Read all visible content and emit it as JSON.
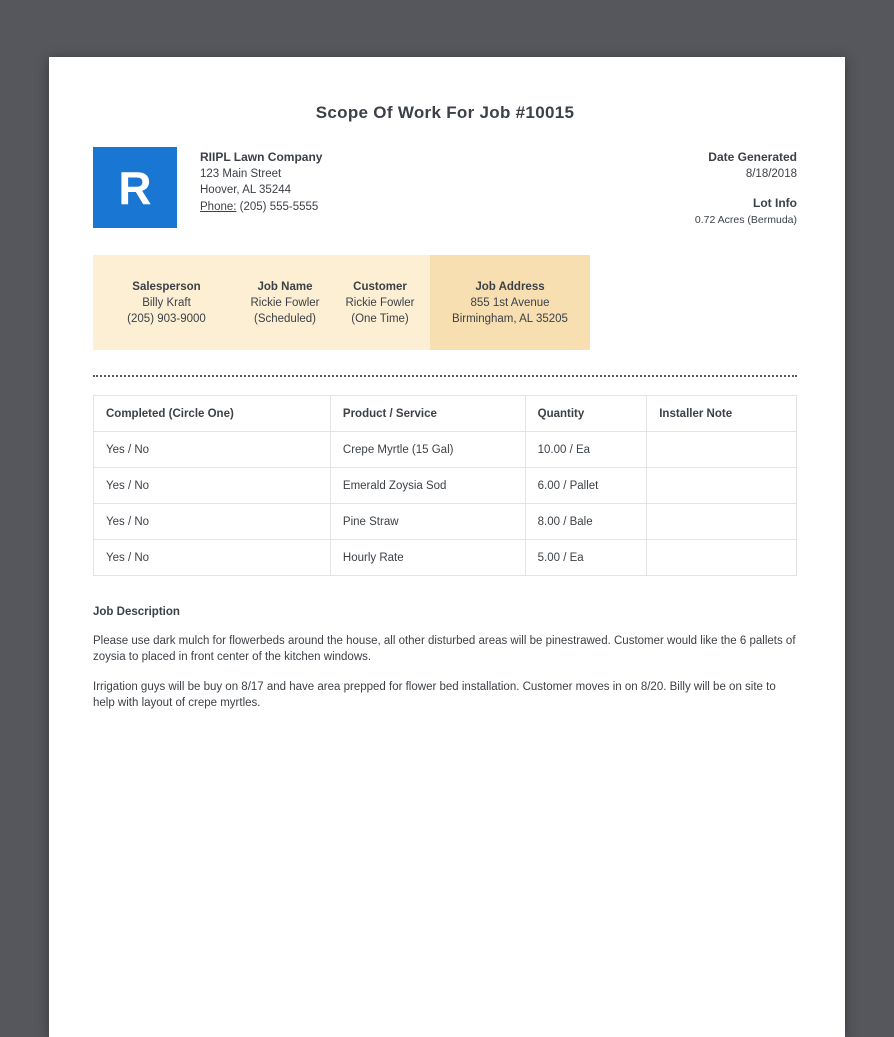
{
  "page": {
    "title": "Scope Of Work For Job #10015"
  },
  "company": {
    "logo_letter": "R",
    "name": "RIIPL Lawn Company",
    "address_line1": "123 Main Street",
    "address_line2": "Hoover, AL 35244",
    "phone_label": "Phone:",
    "phone": "(205) 555-5555"
  },
  "meta": {
    "date_generated_label": "Date Generated",
    "date_generated": "8/18/2018",
    "lot_info_label": "Lot Info",
    "lot_info": "0.72 Acres (Bermuda)"
  },
  "job_summary": {
    "salesperson": {
      "label": "Salesperson",
      "line1": "Billy Kraft",
      "line2": "(205) 903-9000"
    },
    "job_name": {
      "label": "Job Name",
      "line1": "Rickie Fowler",
      "line2": "(Scheduled)"
    },
    "customer": {
      "label": "Customer",
      "line1": "Rickie Fowler",
      "line2": "(One Time)"
    },
    "job_address": {
      "label": "Job Address",
      "line1": "855 1st Avenue",
      "line2": "Birmingham, AL 35205"
    }
  },
  "work_table": {
    "headers": [
      "Completed (Circle One)",
      "Product / Service",
      "Quantity",
      "Installer Note"
    ],
    "rows": [
      {
        "completed": "Yes / No",
        "product": "Crepe Myrtle (15 Gal)",
        "quantity": "10.00 / Ea",
        "note": ""
      },
      {
        "completed": "Yes / No",
        "product": "Emerald Zoysia Sod",
        "quantity": "6.00 / Pallet",
        "note": ""
      },
      {
        "completed": "Yes / No",
        "product": "Pine Straw",
        "quantity": "8.00 / Bale",
        "note": ""
      },
      {
        "completed": "Yes / No",
        "product": "Hourly Rate",
        "quantity": "5.00 / Ea",
        "note": ""
      }
    ]
  },
  "job_description": {
    "label": "Job Description",
    "paragraphs": [
      "Please use dark mulch for flowerbeds around the house, all other disturbed areas will be pinestrawed. Customer would like the 6 pallets of zoysia to placed in front center of the kitchen windows.",
      "Irrigation guys will be buy on 8/17 and have area prepped for flower bed installation. Customer moves in on 8/20. Billy will be on site to help with layout of crepe myrtles."
    ]
  },
  "colors": {
    "viewer_background": "#55575c",
    "page_background": "#ffffff",
    "logo_blue": "#1976d2",
    "summary_band": "#fcefd3",
    "summary_highlight": "#f7dfb2",
    "table_border": "#e3e3e3",
    "text": "#3c4147"
  }
}
